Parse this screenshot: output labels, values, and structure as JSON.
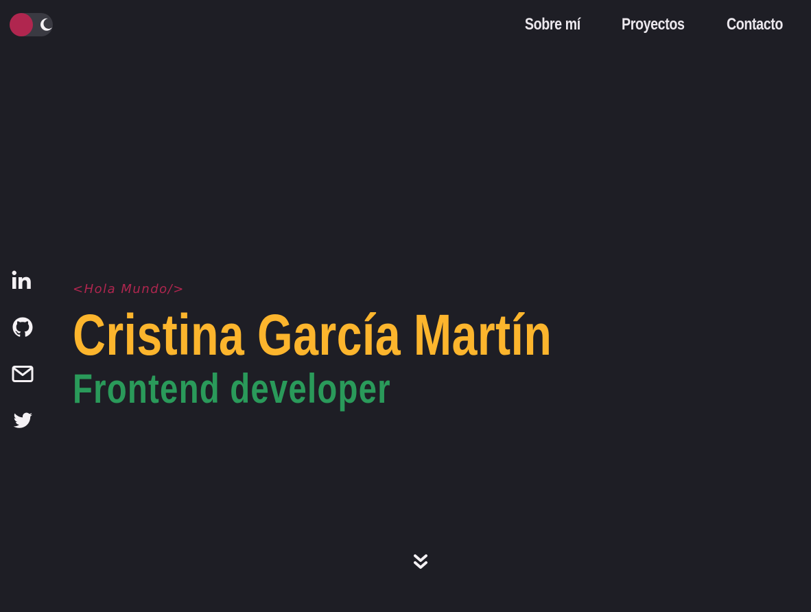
{
  "theme_toggle": {
    "knob_color": "#b0264f",
    "track_color": "#3a3a42",
    "icon": "moon-icon",
    "mode": "dark"
  },
  "nav": {
    "items": [
      {
        "label": "Sobre mí"
      },
      {
        "label": "Proyectos"
      },
      {
        "label": "Contacto"
      }
    ]
  },
  "socials": [
    {
      "icon": "linkedin-icon"
    },
    {
      "icon": "github-icon"
    },
    {
      "icon": "mail-icon"
    },
    {
      "icon": "twitter-icon"
    }
  ],
  "hero": {
    "greeting": "<Hola Mundo/>",
    "name": "Cristina García Martín",
    "role": "Frontend developer"
  },
  "scroll_indicator": {
    "icon": "double-chevron-down-icon"
  },
  "colors": {
    "background": "#1e1e25",
    "accent": "#b0264f",
    "name": "#fcb52d",
    "role": "#2a9a5a",
    "text": "#ece8ee"
  }
}
